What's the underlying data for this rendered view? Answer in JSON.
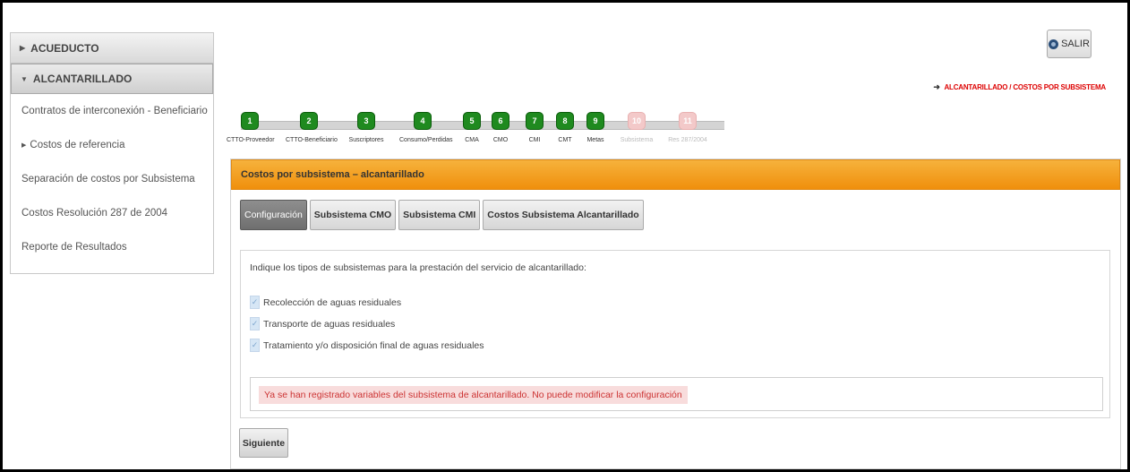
{
  "sidebar": {
    "sections": [
      {
        "label": "ACUEDUCTO",
        "state": "collapsed"
      },
      {
        "label": "ALCANTARILLADO",
        "state": "expanded"
      }
    ],
    "items": [
      {
        "label": "Contratos de interconexión - Beneficiario",
        "has_arrow": false
      },
      {
        "label": "Costos de referencia",
        "has_arrow": true
      },
      {
        "label": "Separación de costos por Subsistema",
        "has_arrow": false
      },
      {
        "label": "Costos Resolución 287 de 2004",
        "has_arrow": false
      },
      {
        "label": "Reporte de Resultados",
        "has_arrow": false
      }
    ]
  },
  "header": {
    "salir_label": "SALIR",
    "breadcrumb": "ALCANTARILLADO / COSTOS POR SUBSISTEMA",
    "breadcrumb_color": "#dd0000"
  },
  "steps": [
    {
      "num": "1",
      "label": "CTTO-Proveedor",
      "enabled": true
    },
    {
      "num": "2",
      "label": "CTTO-Beneficiario",
      "enabled": true
    },
    {
      "num": "3",
      "label": "Suscriptores",
      "enabled": true
    },
    {
      "num": "4",
      "label": "Consumo/Perdidas",
      "enabled": true
    },
    {
      "num": "5",
      "label": "CMA",
      "enabled": true
    },
    {
      "num": "6",
      "label": "CMO",
      "enabled": true
    },
    {
      "num": "7",
      "label": "CMI",
      "enabled": true
    },
    {
      "num": "8",
      "label": "CMT",
      "enabled": true
    },
    {
      "num": "9",
      "label": "Metas",
      "enabled": true
    },
    {
      "num": "10",
      "label": "Subsistema",
      "enabled": false
    },
    {
      "num": "11",
      "label": "Res 287/2004",
      "enabled": false
    }
  ],
  "panel": {
    "title": "Costos por subsistema – alcantarillado",
    "title_color": "#f29f1e",
    "tabs": [
      {
        "label": "Configuración",
        "active": true
      },
      {
        "label": "Subsistema CMO",
        "active": false
      },
      {
        "label": "Subsistema CMI",
        "active": false
      },
      {
        "label": "Costos Subsistema Alcantarillado",
        "active": false
      }
    ],
    "question": "Indique los tipos de subsistemas para la prestación del servicio de alcantarillado:",
    "checkboxes": [
      {
        "label": "Recolección de aguas residuales",
        "checked": true
      },
      {
        "label": "Transporte de aguas residuales",
        "checked": true
      },
      {
        "label": "Tratamiento y/o disposición final de aguas residuales",
        "checked": true
      }
    ],
    "warning": "Ya se han registrado variables del subsistema de alcantarillado. No puede modificar la configuración",
    "next_button": "Siguiente"
  }
}
